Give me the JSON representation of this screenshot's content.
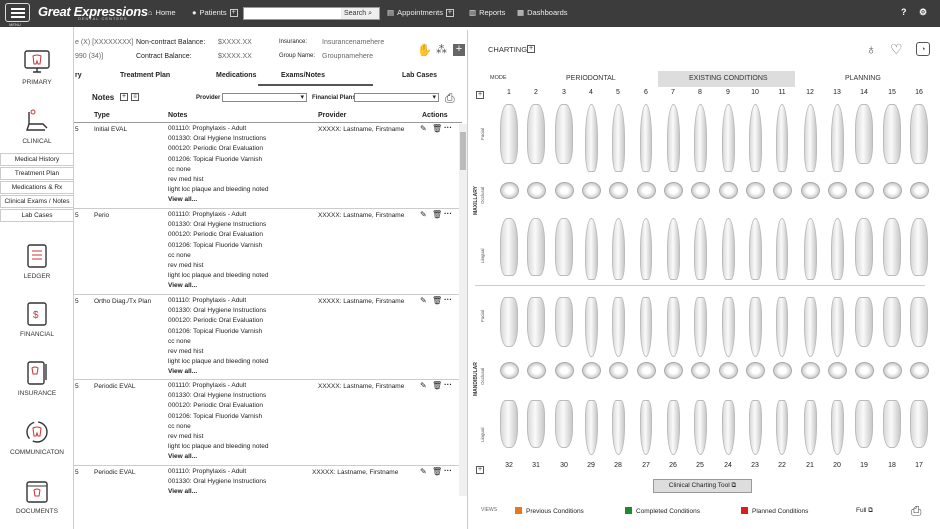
{
  "topbar": {
    "menu_label": "MENU",
    "logo": "Great Expressions",
    "logo_sub": "DENTAL CENTERS",
    "home": "Home",
    "patients": "Patients",
    "search_btn": "Search",
    "appointments": "Appointments",
    "reports": "Reports",
    "dashboards": "Dashboards",
    "help": "?"
  },
  "sidebar": {
    "primary": "PRIMARY",
    "clinical": "CLINICAL",
    "sub": [
      "Medical History",
      "Treatment Plan",
      "Medications & Rx",
      "Clinical Exams / Notes",
      "Lab Cases"
    ],
    "ledger": "LEDGER",
    "financial": "FINANCIAL",
    "insurance": "INSURANCE",
    "communication": "COMMUNICATON",
    "documents": "DOCUMENTS"
  },
  "patient": {
    "line1": "e (X) [XXXXXXXX]",
    "line2": "990 (34)]",
    "noncontract_label": "Non-contract Balance:",
    "noncontract_val": "$XXXX.XX",
    "contract_label": "Contract Balance:",
    "contract_val": "$XXXX.XX",
    "insurance_label": "Insurance:",
    "insurance_val": "Insurancenamehere",
    "group_label": "Group Name:",
    "group_val": "Groupnamehere"
  },
  "tabs": [
    "ry",
    "Treatment Plan",
    "Medications",
    "Exams/Notes",
    "Lab Cases"
  ],
  "notes": {
    "title": "Notes",
    "provider_label": "Provider",
    "financial_label": "Financial Plans",
    "col_type": "Type",
    "col_notes": "Notes",
    "col_provider": "Provider",
    "col_actions": "Actions"
  },
  "rows": [
    {
      "num": "5",
      "type": "Initial EVAL",
      "provider": "XXXXX: Lastname, Firstname",
      "lines": [
        "001110: Prophylaxis - Adult",
        "001330: Oral Hygiene Instructions",
        "000120: Periodic Oral Evaluation",
        "001206: Topical Fluoride Varnish",
        "cc none",
        "rev med hist",
        "light loc plaque and bleeding noted"
      ],
      "more": "View all..."
    },
    {
      "num": "5",
      "type": "Perio",
      "provider": "XXXXX: Lastname, Firstname",
      "lines": [
        "001110: Prophylaxis - Adult",
        "001330: Oral Hygiene Instructions",
        "000120: Periodic Oral Evaluation",
        "001206: Topical Fluoride Varnish",
        "cc none",
        "rev med hist",
        "light loc plaque and bleeding noted"
      ],
      "more": "View all..."
    },
    {
      "num": "5",
      "type": "Ortho Diag./Tx Plan",
      "provider": "XXXXX: Lastname, Firstname",
      "lines": [
        "001110: Prophylaxis - Adult",
        "001330: Oral Hygiene Instructions",
        "000120: Periodic Oral Evaluation",
        "001206: Topical Fluoride Varnish",
        "cc none",
        "rev med hist",
        "light loc plaque and bleeding noted"
      ],
      "more": "View all..."
    },
    {
      "num": "5",
      "type": "Periodic EVAL",
      "provider": "XXXXX: Lastname, Firstname",
      "lines": [
        "001110: Prophylaxis - Adult",
        "001330: Oral Hygiene Instructions",
        "000120: Periodic Oral Evaluation",
        "001206: Topical Fluoride Varnish",
        "cc none",
        "rev med hist",
        "light loc plaque and bleeding noted"
      ],
      "more": "View all..."
    },
    {
      "num": "5",
      "type": "Periodic EVAL",
      "provider": "XXXXX: Lastname, Firstname",
      "lines": [
        "001110: Prophylaxis - Adult",
        "001330: Oral Hygiene Instructions"
      ],
      "more": "View all..."
    }
  ],
  "charting": {
    "title": "CHARTING",
    "mode": "MODE",
    "modes": [
      "PERIODONTAL",
      "EXISTING CONDITIONS",
      "PLANNING"
    ],
    "upper": [
      "1",
      "2",
      "3",
      "4",
      "5",
      "6",
      "7",
      "8",
      "9",
      "10",
      "11",
      "12",
      "13",
      "14",
      "15",
      "16"
    ],
    "lower": [
      "32",
      "31",
      "30",
      "29",
      "28",
      "27",
      "26",
      "25",
      "24",
      "23",
      "22",
      "21",
      "20",
      "19",
      "18",
      "17"
    ],
    "facial": "Facial",
    "occlusal": "Occlusal",
    "lingual": "Lingual",
    "maxillary": "MAXILLARY",
    "mandibular": "MANDIBULAR",
    "tool": "Clinical Charting Tool",
    "views": "VIEWS",
    "legend": [
      {
        "label": "Previous Conditions",
        "color": "#e8771e"
      },
      {
        "label": "Completed Conditions",
        "color": "#1e8a2e"
      },
      {
        "label": "Planned Conditions",
        "color": "#d62020"
      }
    ],
    "full": "Full"
  }
}
